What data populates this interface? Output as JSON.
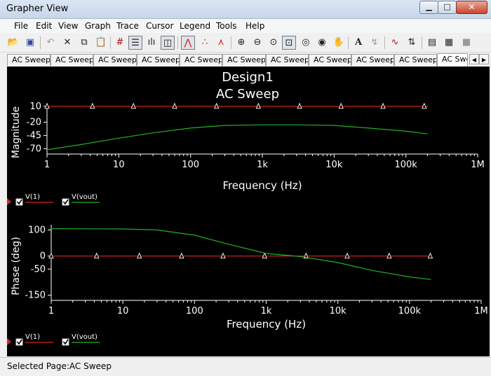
{
  "window": {
    "title": "Grapher View"
  },
  "menu": [
    "File",
    "Edit",
    "View",
    "Graph",
    "Trace",
    "Cursor",
    "Legend",
    "Tools",
    "Help"
  ],
  "tabs": [
    "AC Sweep",
    "AC Sweep",
    "AC Sweep",
    "AC Sweep",
    "AC Sweep",
    "AC Sweep",
    "AC Sweep",
    "AC Sweep",
    "AC Sweep",
    "AC Sweep",
    "AC Swe"
  ],
  "page": {
    "title": "Design1",
    "subtitle": "AC Sweep"
  },
  "status": {
    "text": "Selected Page:AC Sweep"
  },
  "chart_data": [
    {
      "type": "line",
      "ylabel": "Magnitude",
      "xlabel": "Frequency (Hz)",
      "x_scale": "log",
      "xlim": [
        1,
        1000000
      ],
      "ylim": [
        -80,
        15
      ],
      "xticks": [
        "1",
        "10",
        "100",
        "1k",
        "10k",
        "100k",
        "1M"
      ],
      "yticks": [
        {
          "v": 10,
          "label": "10"
        },
        {
          "v": -20,
          "label": "-20"
        },
        {
          "v": -45,
          "label": "-45"
        },
        {
          "v": -70,
          "label": "-70"
        }
      ],
      "series": [
        {
          "name": "V(1)",
          "color": "#e02020",
          "marker": "triangle",
          "x": [
            1,
            200000
          ],
          "y": [
            10,
            10
          ],
          "markers_x": [
            1,
            4.3,
            16,
            60,
            230,
            880,
            3300,
            12500,
            48000,
            180000
          ]
        },
        {
          "name": "V(vout)",
          "color": "#22b022",
          "x": [
            1,
            3,
            10,
            30,
            100,
            300,
            1000,
            3000,
            10000,
            30000,
            100000,
            200000
          ],
          "y": [
            -72,
            -62,
            -50,
            -40,
            -31,
            -26,
            -25,
            -25,
            -26,
            -31,
            -37,
            -42
          ]
        }
      ],
      "legend": [
        "V(1)",
        "V(vout)"
      ]
    },
    {
      "type": "line",
      "ylabel": "Phase (deg)",
      "xlabel": "Frequency (Hz)",
      "x_scale": "log",
      "xlim": [
        1,
        1000000
      ],
      "ylim": [
        -170,
        120
      ],
      "xticks": [
        "1",
        "10",
        "100",
        "1k",
        "10k",
        "100k",
        "1M"
      ],
      "yticks": [
        {
          "v": 100,
          "label": "100"
        },
        {
          "v": 0,
          "label": "0"
        },
        {
          "v": -50,
          "label": "-50"
        },
        {
          "v": -150,
          "label": "-150"
        }
      ],
      "series": [
        {
          "name": "V(1)",
          "color": "#e02020",
          "marker": "triangle",
          "x": [
            1,
            200000
          ],
          "y": [
            0,
            0
          ],
          "markers_x": [
            1,
            4.3,
            17,
            66,
            250,
            950,
            3600,
            13500,
            52000,
            195000
          ]
        },
        {
          "name": "V(vout)",
          "color": "#22b022",
          "x": [
            1,
            10,
            30,
            100,
            300,
            1000,
            3000,
            10000,
            30000,
            100000,
            200000
          ],
          "y": [
            105,
            104,
            100,
            80,
            45,
            10,
            -2,
            -25,
            -55,
            -80,
            -90
          ]
        }
      ],
      "legend": [
        "V(1)",
        "V(vout)"
      ]
    }
  ]
}
